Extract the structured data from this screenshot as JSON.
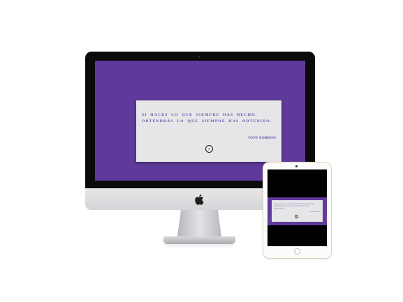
{
  "imac_screen": {
    "quote": "Si haces lo que siempre has hecho, obtendrás lo que siempre has obtenido.",
    "author": "Tony Robbins",
    "next_icon": "chevron-right-circle-icon",
    "next_glyph": "›",
    "bg_color": "#5f3a9b",
    "card_color": "#e6e6e8",
    "text_color": "#6b53a5"
  },
  "ipad_screen": {
    "quote": "Si haces lo que siempre has hecho, obtendrás lo que siempre has obtenido.",
    "author": "Tony Robbins",
    "next_icon": "chevron-right-circle-icon",
    "next_glyph": "›"
  },
  "icons": {
    "apple_logo": "apple-logo-icon"
  }
}
